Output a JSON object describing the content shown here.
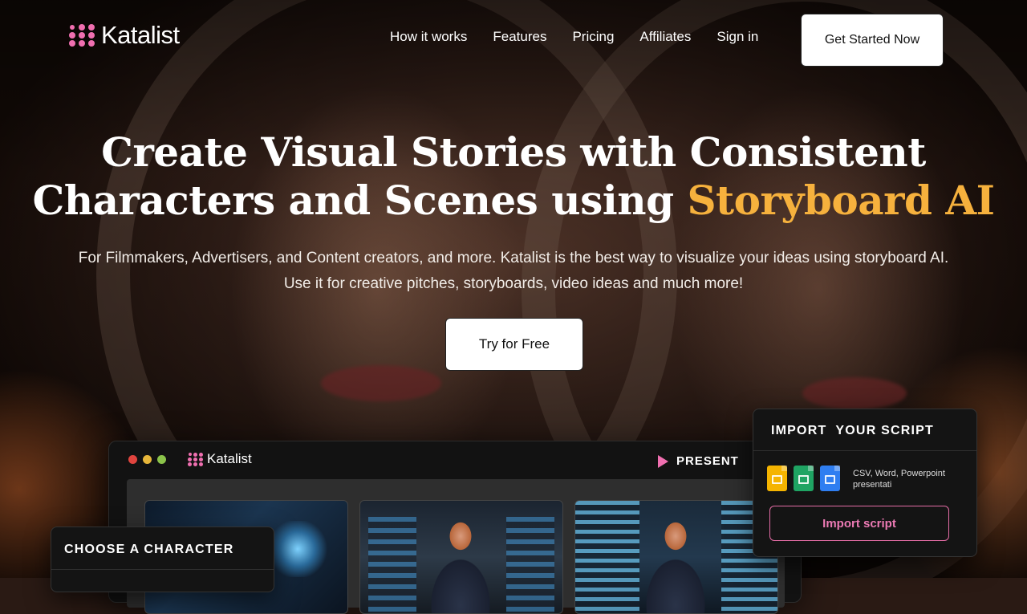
{
  "brand": {
    "name": "Katalist",
    "accent_color": "#f06fb0"
  },
  "nav": {
    "items": [
      "How it works",
      "Features",
      "Pricing",
      "Affiliates",
      "Sign in"
    ],
    "cta": "Get Started Now"
  },
  "hero": {
    "title_part1": "Create Visual Stories with Consistent",
    "title_part2": "Characters and Scenes using ",
    "title_accent": "Storyboard AI",
    "accent_color": "#f6b13d",
    "subtitle_line1": "For Filmmakers, Advertisers, and Content creators, and more. Katalist is the best way to visualize your ideas using storyboard AI.",
    "subtitle_line2": "Use it for creative pitches, storyboards, video ideas and much more!",
    "cta": "Try for Free"
  },
  "app_preview": {
    "logo_text": "Katalist",
    "present_label": "PRESENT",
    "traffic_colors": [
      "#e0443e",
      "#e7b63a",
      "#8bc34a"
    ]
  },
  "import_card": {
    "title": "IMPORT  YOUR SCRIPT",
    "file_types": "CSV, Word, Powerpoint presentati",
    "icons": [
      "slides-icon",
      "sheets-icon",
      "docs-icon"
    ],
    "button": "Import script"
  },
  "character_card": {
    "title": "CHOOSE A CHARACTER"
  }
}
